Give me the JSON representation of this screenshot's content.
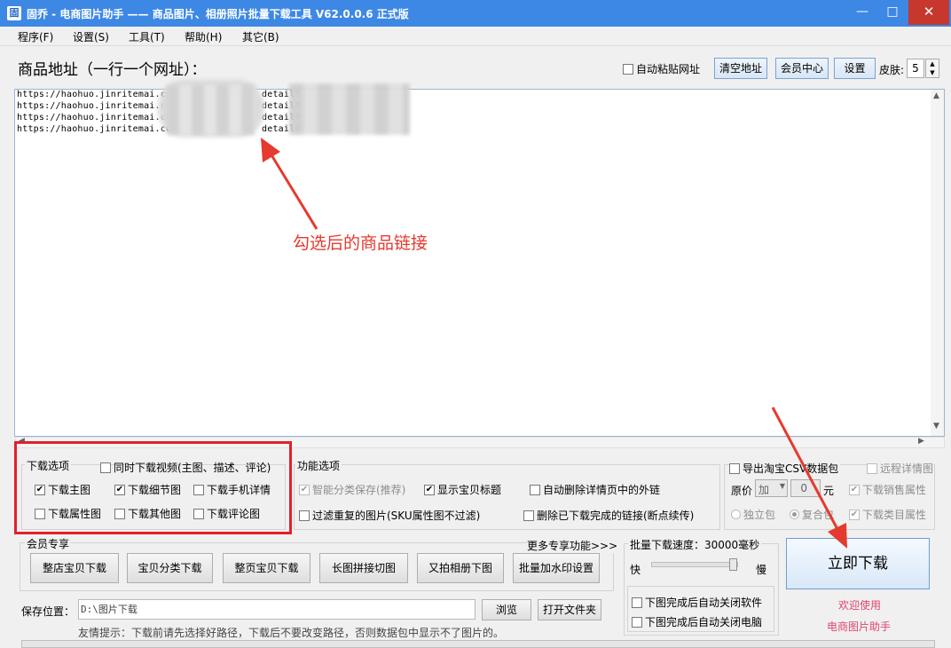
{
  "window": {
    "title": "固乔 - 电商图片助手 —— 商品图片、相册照片批量下载工具 V62.0.0.6 正式版",
    "icon_glyph": "固",
    "minimize": "—",
    "maximize": "□",
    "close": "✕"
  },
  "menu": [
    "程序(F)",
    "设置(S)",
    "工具(T)",
    "帮助(H)",
    "其它(B)"
  ],
  "url_panel": {
    "title": "商品地址（一行一个网址）：",
    "auto_paste_label": "自动粘贴网址",
    "auto_paste_checked": false,
    "clear_button": "清空地址",
    "member_center_button": "会员中心",
    "settings_button": "设置",
    "skin_label": "皮肤:",
    "skin_value": "5",
    "urls": [
      "https://haohuo.jinritemai.co",
      "https://haohuo.jinritemai.co",
      "https://haohuo.jinritemai.co",
      "https://haohuo.jinritemai.co"
    ],
    "url_suffix": "detail?"
  },
  "annotation": "勾选后的商品链接",
  "download_options": {
    "title": "下载选项",
    "video": {
      "label": "同时下载视频(主图、描述、评论)",
      "checked": false
    },
    "items": [
      {
        "label": "下载主图",
        "checked": true
      },
      {
        "label": "下载细节图",
        "checked": true
      },
      {
        "label": "下载手机详情",
        "checked": false
      },
      {
        "label": "下载属性图",
        "checked": false
      },
      {
        "label": "下载其他图",
        "checked": false
      },
      {
        "label": "下载评论图",
        "checked": false
      }
    ]
  },
  "function_options": {
    "title": "功能选项",
    "items": [
      {
        "label": "智能分类保存(推荐)",
        "checked": true,
        "disabled": true
      },
      {
        "label": "显示宝贝标题",
        "checked": true,
        "disabled": false
      },
      {
        "label": "自动删除详情页中的外链",
        "checked": false,
        "disabled": false
      },
      {
        "label": "过滤重复的图片(SKU属性图不过滤)",
        "checked": false,
        "disabled": false
      },
      {
        "label": "删除已下载完成的链接(断点续传)",
        "checked": false,
        "disabled": false
      }
    ]
  },
  "csv_panel": {
    "export_label": "导出淘宝CSV数据包",
    "export_checked": false,
    "remote_label": "远程详情图",
    "price_label": "原价",
    "price_op": "加",
    "price_value": "0",
    "price_unit": "元",
    "sales_attr_label": "下载销售属性",
    "standalone_label": "独立包",
    "combined_label": "复合包",
    "category_attr_label": "下载类目属性"
  },
  "member_panel": {
    "title": "会员专享",
    "more_link": "更多专享功能>>>",
    "buttons": [
      "整店宝贝下载",
      "宝贝分类下载",
      "整页宝贝下载",
      "长图拼接切图",
      "又拍相册下图",
      "批量加水印设置"
    ]
  },
  "speed_panel": {
    "title": "批量下载速度：30000毫秒",
    "fast": "快",
    "slow": "慢",
    "speed_level": 0.95,
    "close_app_label": "下图完成后自动关闭软件",
    "shutdown_label": "下图完成后自动关闭电脑"
  },
  "download_button": "立即下载",
  "welcome": [
    "欢迎使用",
    "电商图片助手"
  ],
  "save": {
    "label": "保存位置：",
    "path": "D:\\图片下载",
    "browse_button": "浏览",
    "open_folder_button": "打开文件夹",
    "tip": "友情提示：下载前请先选择好路径，下载后不要改变路径，否则数据包中显示不了图片的。"
  },
  "colors": {
    "titlebar": "#3d88e4",
    "annotation_red": "#e53a2f",
    "welcome_pink": "#e0456d"
  }
}
